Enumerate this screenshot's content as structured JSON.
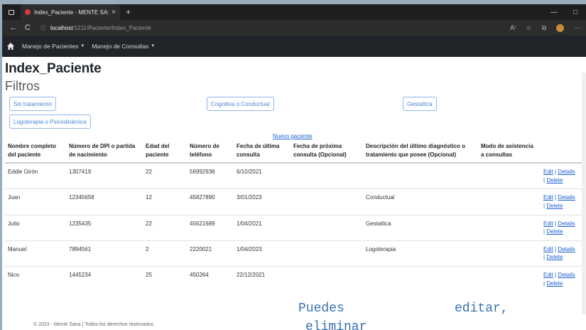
{
  "browser": {
    "tab_title": "Index_Paciente - MENTE SANA",
    "tab_close": "×",
    "new_tab": "+",
    "url_host": "localhost",
    "url_path": ":5211/Paciente/Index_Paciente",
    "min": "—",
    "restore": "□",
    "back": "←",
    "reload": "C",
    "info": "ⓘ",
    "read": "A⁾",
    "favs": "☆",
    "collections": "⧉",
    "more": "···"
  },
  "nav": {
    "menu1": "Manejo de Pacientes",
    "menu2": "Manejo de Consultas"
  },
  "page": {
    "title": "Index_Paciente",
    "subtitle": "Filtros"
  },
  "filters": {
    "sin_tratamiento": "Sin tratamiento",
    "cognitiva": "Cognitiva o Conductual",
    "gestaltica": "Gestaltica",
    "logoterapia": "Logoterapia o Psicodinámica",
    "nuevo": "Nuevo paciente"
  },
  "table": {
    "headers": [
      "Nombre completo del paciente",
      "Número de DPI o partida de nacimiento",
      "Edad del paciente",
      "Número de teléfono",
      "Fecha de última consulta",
      "Fecha de próxima consulta (Opcional)",
      "Descripción del último diagnóstico o tratamiento que posee (Opcional)",
      "Modo de asistencia a consultas"
    ],
    "rows": [
      {
        "nombre": "Eddie Girón",
        "dpi": "1307419",
        "edad": "22",
        "tel": "56992936",
        "ultima": "6/10/2021",
        "proxima": "",
        "desc": "",
        "modo": ""
      },
      {
        "nombre": "Juan",
        "dpi": "12345658",
        "edad": "12",
        "tel": "45827890",
        "ultima": "3/01/2023",
        "proxima": "",
        "desc": "Conductual",
        "modo": ""
      },
      {
        "nombre": "Julio",
        "dpi": "1235435",
        "edad": "22",
        "tel": "45621689",
        "ultima": "1/04/2021",
        "proxima": "",
        "desc": "Gestaltica",
        "modo": ""
      },
      {
        "nombre": "Manuel",
        "dpi": "7894561",
        "edad": "2",
        "tel": "2220021",
        "ultima": "1/04/2023",
        "proxima": "",
        "desc": "Logoterapia",
        "modo": ""
      },
      {
        "nombre": "Nico",
        "dpi": "1445234",
        "edad": "25",
        "tel": "450264",
        "ultima": "22/12/2021",
        "proxima": "",
        "desc": "",
        "modo": ""
      }
    ],
    "edit": "Edit",
    "details": "Details",
    "delete": "Delete"
  },
  "footer": "© 2023 - Mente Sana | Todos los derechos reservados",
  "overlay": {
    "line1a": "Puedes",
    "line1b": "editar,",
    "line2": "eliminar"
  }
}
